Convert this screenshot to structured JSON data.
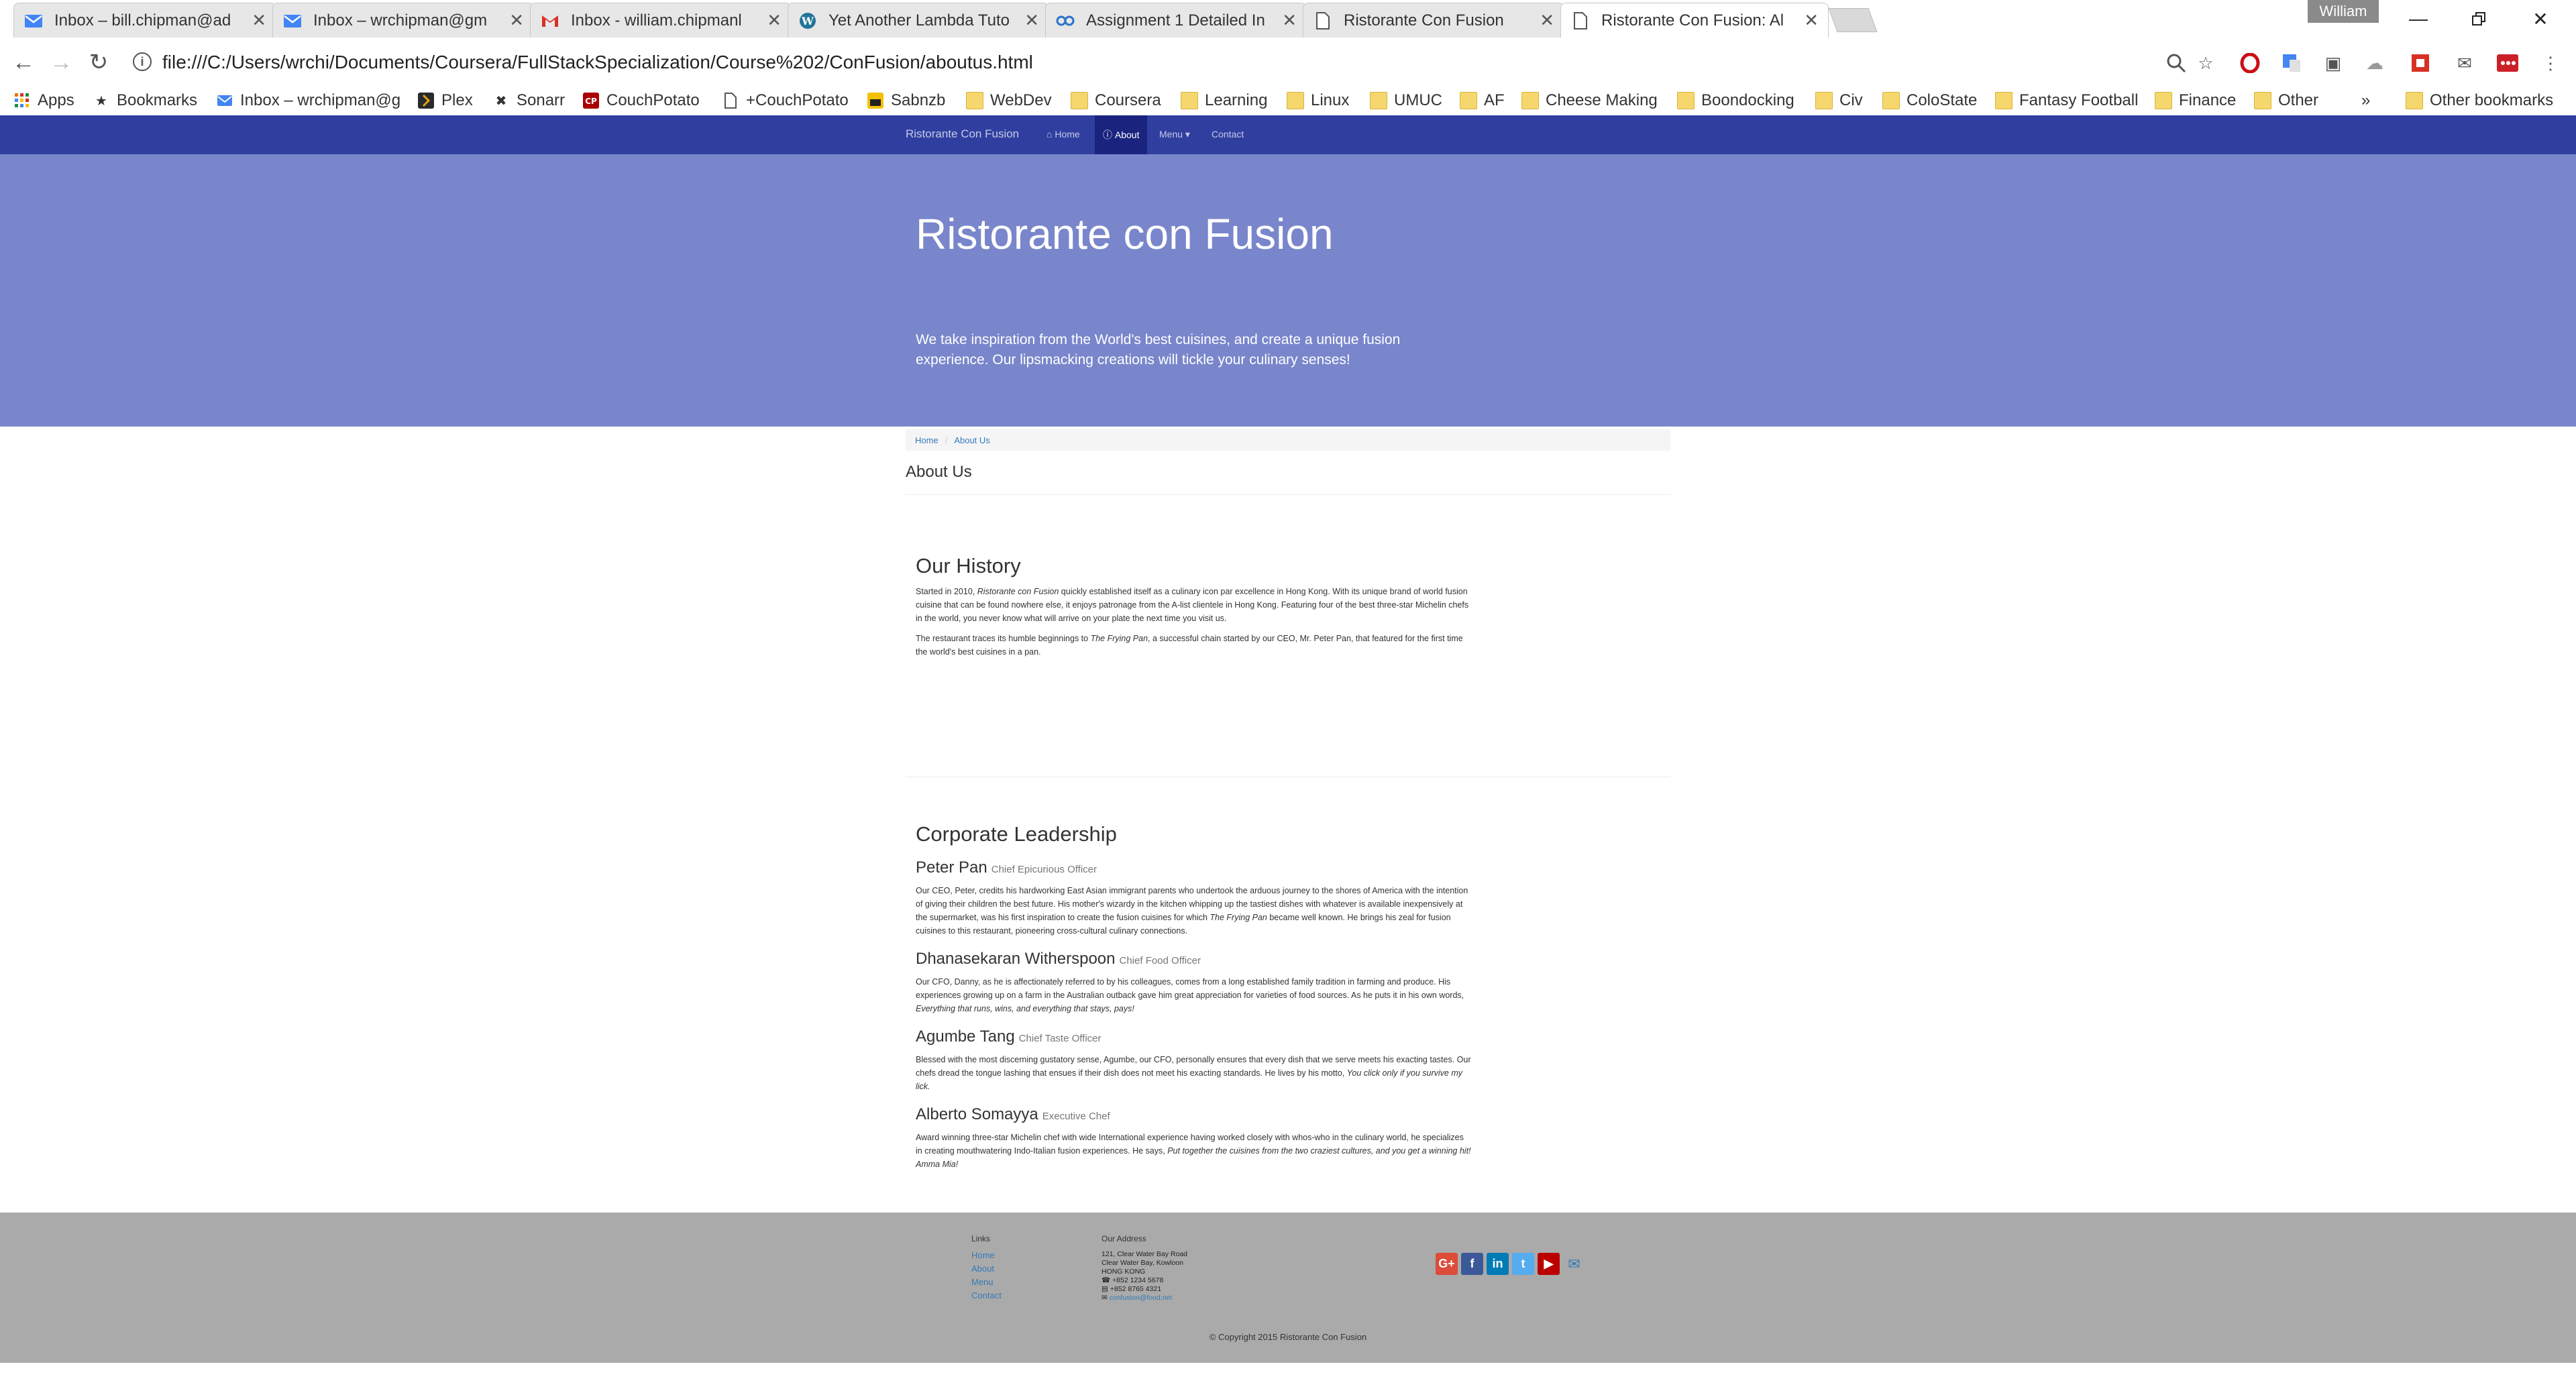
{
  "browser": {
    "tabs": [
      {
        "title": "Inbox – bill.chipman@ad",
        "icon": "inbox-icon",
        "active": false
      },
      {
        "title": "Inbox – wrchipman@gm",
        "icon": "inbox-icon",
        "active": false
      },
      {
        "title": "Inbox - william.chipmanl",
        "icon": "gmail-icon",
        "active": false
      },
      {
        "title": "Yet Another Lambda Tuto",
        "icon": "wordpress-icon",
        "active": false
      },
      {
        "title": "Assignment 1 Detailed In",
        "icon": "coursera-icon",
        "active": false
      },
      {
        "title": "Ristorante Con Fusion",
        "icon": "page-icon",
        "active": false
      },
      {
        "title": "Ristorante Con Fusion: Al",
        "icon": "page-icon",
        "active": true
      }
    ],
    "user": "William",
    "url": "file:///C:/Users/wrchi/Documents/Coursera/FullStackSpecialization/Course%202/ConFusion/aboutus.html",
    "bookmarks": [
      {
        "label": "Apps",
        "icon": "apps-grid-icon"
      },
      {
        "label": "Bookmarks",
        "icon": "star-icon"
      },
      {
        "label": "Inbox – wrchipman@g",
        "icon": "inbox-icon"
      },
      {
        "label": "Plex",
        "icon": "plex-icon"
      },
      {
        "label": "Sonarr",
        "icon": "sonarr-icon"
      },
      {
        "label": "CouchPotato",
        "icon": "couchpotato-icon"
      },
      {
        "label": "+CouchPotato",
        "icon": "page-icon"
      },
      {
        "label": "Sabnzb",
        "icon": "sabnzb-icon"
      },
      {
        "label": "WebDev",
        "icon": "folder-icon"
      },
      {
        "label": "Coursera",
        "icon": "folder-icon"
      },
      {
        "label": "Learning",
        "icon": "folder-icon"
      },
      {
        "label": "Linux",
        "icon": "folder-icon"
      },
      {
        "label": "UMUC",
        "icon": "folder-icon"
      },
      {
        "label": "AF",
        "icon": "folder-icon"
      },
      {
        "label": "Cheese Making",
        "icon": "folder-icon"
      },
      {
        "label": "Boondocking",
        "icon": "folder-icon"
      },
      {
        "label": "Civ",
        "icon": "folder-icon"
      },
      {
        "label": "ColoState",
        "icon": "folder-icon"
      },
      {
        "label": "Fantasy Football",
        "icon": "folder-icon"
      },
      {
        "label": "Finance",
        "icon": "folder-icon"
      },
      {
        "label": "Other",
        "icon": "folder-icon"
      }
    ],
    "overflow_chevron": "»",
    "other_bookmarks": "Other bookmarks"
  },
  "site": {
    "brand": "Ristorante Con Fusion",
    "nav": [
      {
        "label": "Home",
        "icon": "home-icon"
      },
      {
        "label": "About",
        "icon": "info-icon"
      },
      {
        "label": "Menu ▾",
        "icon": ""
      },
      {
        "label": "Contact",
        "icon": ""
      }
    ],
    "jumbotron": {
      "title": "Ristorante con Fusion",
      "text": "We take inspiration from the World's best cuisines, and create a unique fusion experience. Our lipsmacking creations will tickle your culinary senses!"
    },
    "breadcrumb": [
      "Home",
      "About Us"
    ],
    "page_title": "About Us",
    "history": {
      "heading": "Our History",
      "p1_a": "Started in 2010, ",
      "p1_em": "Ristorante con Fusion",
      "p1_b": " quickly established itself as a culinary icon par excellence in Hong Kong. With its unique brand of world fusion cuisine that can be found nowhere else, it enjoys patronage from the A-list clientele in Hong Kong. Featuring four of the best three-star Michelin chefs in the world, you never know what will arrive on your plate the next time you visit us.",
      "p2_a": "The restaurant traces its humble beginnings to ",
      "p2_em": "The Frying Pan",
      "p2_b": ", a successful chain started by our CEO, Mr. Peter Pan, that featured for the first time the world's best cuisines in a pan."
    },
    "leadership": {
      "heading": "Corporate Leadership",
      "leaders": [
        {
          "name": "Peter Pan",
          "role": "Chief Epicurious Officer",
          "bio_a": "Our CEO, Peter, credits his hardworking East Asian immigrant parents who undertook the arduous journey to the shores of America with the intention of giving their children the best future. His mother's wizardy in the kitchen whipping up the tastiest dishes with whatever is available inexpensively at the supermarket, was his first inspiration to create the fusion cuisines for which ",
          "bio_em": "The Frying Pan",
          "bio_b": " became well known. He brings his zeal for fusion cuisines to this restaurant, pioneering cross-cultural culinary connections."
        },
        {
          "name": "Dhanasekaran Witherspoon",
          "role": "Chief Food Officer",
          "bio_a": "Our CFO, Danny, as he is affectionately referred to by his colleagues, comes from a long established family tradition in farming and produce. His experiences growing up on a farm in the Australian outback gave him great appreciation for varieties of food sources. As he puts it in his own words, ",
          "bio_em": "Everything that runs, wins, and everything that stays, pays!",
          "bio_b": ""
        },
        {
          "name": "Agumbe Tang",
          "role": "Chief Taste Officer",
          "bio_a": "Blessed with the most discerning gustatory sense, Agumbe, our CFO, personally ensures that every dish that we serve meets his exacting tastes. Our chefs dread the tongue lashing that ensues if their dish does not meet his exacting standards. He lives by his motto, ",
          "bio_em": "You click only if you survive my lick.",
          "bio_b": ""
        },
        {
          "name": "Alberto Somayya",
          "role": "Executive Chef",
          "bio_a": "Award winning three-star Michelin chef with wide International experience having worked closely with whos-who in the culinary world, he specializes in creating mouthwatering Indo-Italian fusion experiences. He says, ",
          "bio_em": "Put together the cuisines from the two craziest cultures, and you get a winning hit! Amma Mia!",
          "bio_b": ""
        }
      ]
    },
    "footer": {
      "links_heading": "Links",
      "links": [
        "Home",
        "About",
        "Menu",
        "Contact"
      ],
      "address_heading": "Our Address",
      "address_lines": [
        "121, Clear Water Bay Road",
        "Clear Water Bay, Kowloon",
        "HONG KONG"
      ],
      "phone": "+852 1234 5678",
      "fax": "+852 8765 4321",
      "email": "confusion@food.net",
      "social": [
        {
          "icon": "google-plus-icon",
          "glyph": "G+",
          "color": "#dd4b39"
        },
        {
          "icon": "facebook-icon",
          "glyph": "f",
          "color": "#3b5998"
        },
        {
          "icon": "linkedin-icon",
          "glyph": "in",
          "color": "#007bb6"
        },
        {
          "icon": "twitter-icon",
          "glyph": "t",
          "color": "#55acee"
        },
        {
          "icon": "youtube-icon",
          "glyph": "▶",
          "color": "#bb0000"
        },
        {
          "icon": "mail-icon",
          "glyph": "✉",
          "color": "transparent"
        }
      ],
      "copyright": "© Copyright 2015 Ristorante Con Fusion"
    }
  }
}
